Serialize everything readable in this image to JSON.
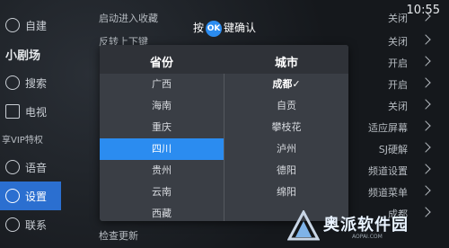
{
  "status": {
    "clock": "10:55"
  },
  "hint": {
    "prefix": "按",
    "ok_key": "OK",
    "suffix": "键确认"
  },
  "sidebar": {
    "items": [
      {
        "label": "自建",
        "icon": "home-icon"
      },
      {
        "label": "小剧场",
        "icon": "logo-text"
      },
      {
        "label": "搜索",
        "icon": "search-icon"
      },
      {
        "label": "电视",
        "icon": "tv-icon"
      },
      {
        "label": "享VIP特权",
        "icon": ""
      },
      {
        "label": "语音",
        "icon": "mic-icon"
      },
      {
        "label": "设置",
        "icon": "gear-icon",
        "active": true
      },
      {
        "label": "联系",
        "icon": "contact-icon"
      }
    ]
  },
  "settings": {
    "rows": [
      {
        "label": "启动进入收藏",
        "value": "关闭"
      },
      {
        "label": "反转上下键",
        "value": "关闭"
      },
      {
        "label": "",
        "value": "开启"
      },
      {
        "label": "",
        "value": "开启"
      },
      {
        "label": "",
        "value": "关闭"
      },
      {
        "label": "",
        "value": "适应屏幕"
      },
      {
        "label": "",
        "value": "SJ硬解"
      },
      {
        "label": "",
        "value": "频道设置"
      },
      {
        "label": "",
        "value": "频道菜单"
      },
      {
        "label": "",
        "value": "成都"
      },
      {
        "label": "检查更新",
        "value": ""
      }
    ]
  },
  "dialog": {
    "province_header": "省份",
    "city_header": "城市",
    "provinces": [
      "广西",
      "海南",
      "重庆",
      "四川",
      "贵州",
      "云南",
      "西藏"
    ],
    "selected_province": "四川",
    "cities": [
      "成都✓",
      "自贡",
      "攀枝花",
      "泸州",
      "德阳",
      "绵阳"
    ],
    "current_city": "成都✓"
  },
  "watermark": {
    "text": "奥派软件园",
    "sub": "AOPAI.COM"
  },
  "colors": {
    "accent": "#2b8cf0",
    "sidebar_active": "#2b6fd0"
  }
}
